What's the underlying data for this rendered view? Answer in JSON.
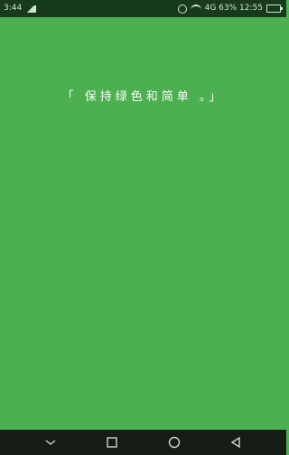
{
  "status_bar": {
    "left_time": "3:44",
    "right_info": "4G  63%  12:55"
  },
  "main": {
    "quote": "「 保持绿色和简单 。」"
  },
  "nav_bar": {
    "buttons": [
      "chevron-down-icon",
      "square-icon",
      "circle-icon",
      "triangle-left-icon"
    ]
  }
}
